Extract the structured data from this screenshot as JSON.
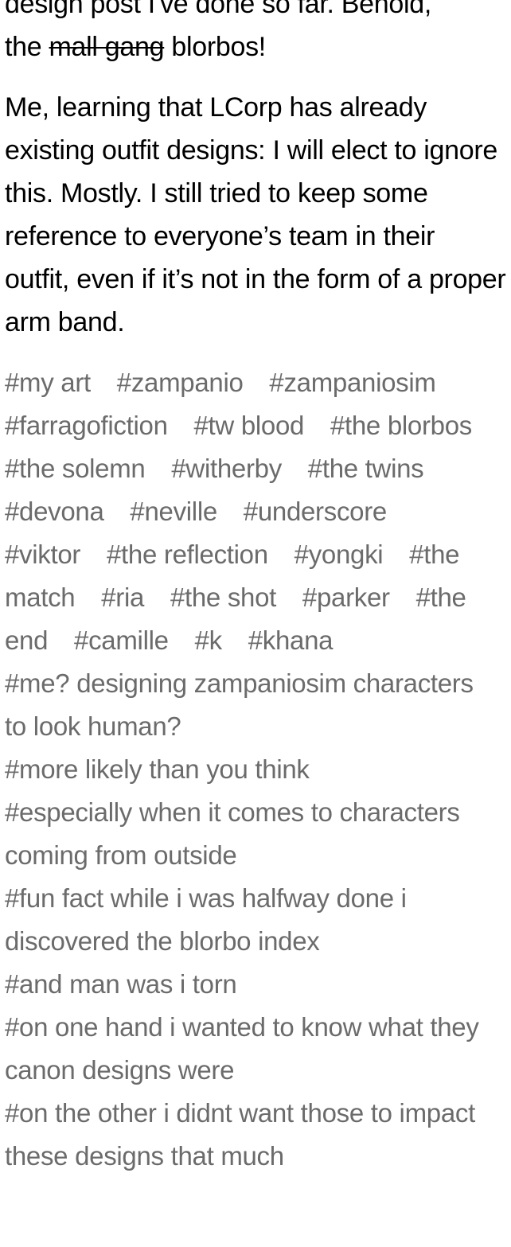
{
  "post": {
    "paragraphs": {
      "p1": {
        "line1": "design post I've done so far. Behold,",
        "before_strike": "the ",
        "strike": "mall gang",
        "after_strike": " blorbos!"
      },
      "p2": "Me, learning that LCorp has already existing outfit designs: I will elect to ignore this. Mostly. I still tried to keep some reference to everyone’s team in their outfit, even if it’s not in the form of a proper arm band."
    },
    "tags": [
      "#my art",
      "#zampanio",
      "#zampaniosim",
      "#farragofiction",
      "#tw blood",
      "#the blorbos",
      "#the solemn",
      "#witherby",
      "#the twins",
      "#devona",
      "#neville",
      "#underscore",
      "#viktor",
      "#the reflection",
      "#yongki",
      "#the match",
      "#ria",
      "#the shot",
      "#parker",
      "#the end",
      "#camille",
      "#k",
      "#khana",
      "#me? designing zampaniosim characters to look human?",
      "#more likely than you think",
      "#especially when it comes to characters coming from outside",
      "#fun fact while i was halfway done i discovered the blorbo index",
      "#and man was i torn",
      "#on one hand i wanted to know what they canon designs were",
      "#on the other i didnt want those to impact these designs that much"
    ],
    "colors": {
      "text": "#000000",
      "tag": "#6b6b6b",
      "background": "#ffffff"
    }
  }
}
